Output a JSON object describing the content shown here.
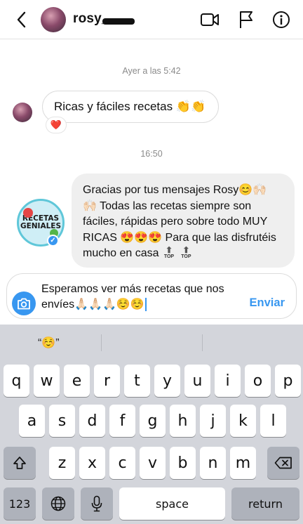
{
  "header": {
    "username": "rosy_",
    "back_icon": "chevron-left-icon",
    "icons": [
      "video-camera-icon",
      "flag-icon",
      "info-icon"
    ]
  },
  "chat": {
    "timestamp_1": "Ayer a las 5:42",
    "incoming_message": "Ricas y fáciles recetas 👏👏",
    "reaction": "❤️",
    "timestamp_2": "16:50",
    "outgoing_message": "Gracias por tus mensajes Rosy😊🙌🏻 🙌🏻 Todas las recetas siempre son fáciles, rápidas pero sobre todo MUY RICAS 😍😍😍 Para que las disfrutéis mucho en casa",
    "top_label": "TOP",
    "logo_text": [
      "RECETAS",
      "GENIALES"
    ]
  },
  "composer": {
    "text": "Esperamos ver más recetas que nos envíes🙏🏻🙏🏻🙏🏻☺️☺️",
    "send_label": "Enviar"
  },
  "keyboard": {
    "suggestion": "“☺️”",
    "row1": [
      "q",
      "w",
      "e",
      "r",
      "t",
      "y",
      "u",
      "i",
      "o",
      "p"
    ],
    "row2": [
      "a",
      "s",
      "d",
      "f",
      "g",
      "h",
      "j",
      "k",
      "l"
    ],
    "row3": [
      "z",
      "x",
      "c",
      "v",
      "b",
      "n",
      "m"
    ],
    "numbers_label": "123",
    "space_label": "space",
    "return_label": "return"
  },
  "colors": {
    "accent": "#3897f0",
    "keyboard_bg": "#d3d5db"
  }
}
